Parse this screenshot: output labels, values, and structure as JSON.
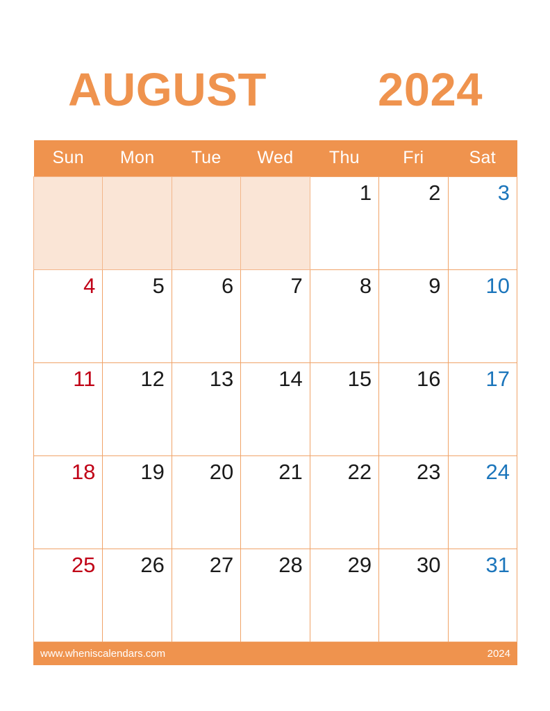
{
  "title": {
    "month": "AUGUST",
    "year": "2024"
  },
  "colors": {
    "accent_orange": "#EF934E",
    "grid_border": "#F0A368",
    "empty_cell": "#FAE5D6",
    "sunday_red": "#C00016",
    "saturday_blue": "#1B75BB",
    "weekday_black": "#1a1a1a",
    "header_text": "#FFFFFF"
  },
  "weekdays": [
    "Sun",
    "Mon",
    "Tue",
    "Wed",
    "Thu",
    "Fri",
    "Sat"
  ],
  "weeks": [
    [
      {
        "day": "",
        "kind": "empty"
      },
      {
        "day": "",
        "kind": "empty"
      },
      {
        "day": "",
        "kind": "empty"
      },
      {
        "day": "",
        "kind": "empty"
      },
      {
        "day": "1",
        "kind": "weekday"
      },
      {
        "day": "2",
        "kind": "weekday"
      },
      {
        "day": "3",
        "kind": "saturday"
      }
    ],
    [
      {
        "day": "4",
        "kind": "sunday"
      },
      {
        "day": "5",
        "kind": "weekday"
      },
      {
        "day": "6",
        "kind": "weekday"
      },
      {
        "day": "7",
        "kind": "weekday"
      },
      {
        "day": "8",
        "kind": "weekday"
      },
      {
        "day": "9",
        "kind": "weekday"
      },
      {
        "day": "10",
        "kind": "saturday"
      }
    ],
    [
      {
        "day": "11",
        "kind": "sunday"
      },
      {
        "day": "12",
        "kind": "weekday"
      },
      {
        "day": "13",
        "kind": "weekday"
      },
      {
        "day": "14",
        "kind": "weekday"
      },
      {
        "day": "15",
        "kind": "weekday"
      },
      {
        "day": "16",
        "kind": "weekday"
      },
      {
        "day": "17",
        "kind": "saturday"
      }
    ],
    [
      {
        "day": "18",
        "kind": "sunday"
      },
      {
        "day": "19",
        "kind": "weekday"
      },
      {
        "day": "20",
        "kind": "weekday"
      },
      {
        "day": "21",
        "kind": "weekday"
      },
      {
        "day": "22",
        "kind": "weekday"
      },
      {
        "day": "23",
        "kind": "weekday"
      },
      {
        "day": "24",
        "kind": "saturday"
      }
    ],
    [
      {
        "day": "25",
        "kind": "sunday"
      },
      {
        "day": "26",
        "kind": "weekday"
      },
      {
        "day": "27",
        "kind": "weekday"
      },
      {
        "day": "28",
        "kind": "weekday"
      },
      {
        "day": "29",
        "kind": "weekday"
      },
      {
        "day": "30",
        "kind": "weekday"
      },
      {
        "day": "31",
        "kind": "saturday"
      }
    ]
  ],
  "footer": {
    "site": "www.wheniscalendars.com",
    "year": "2024"
  }
}
